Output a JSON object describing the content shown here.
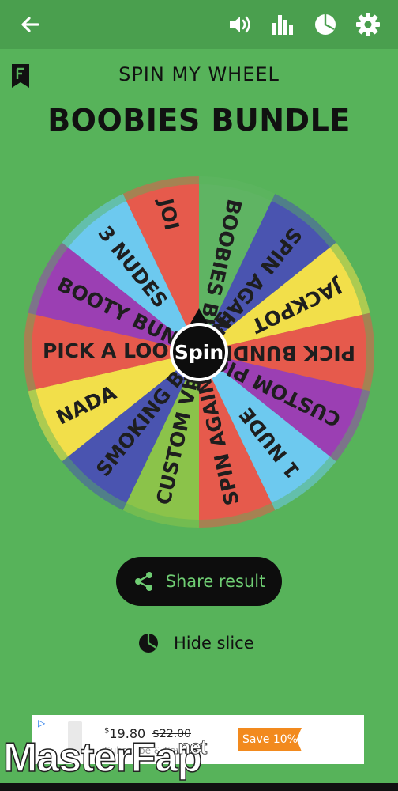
{
  "app": {
    "subtitle": "SPIN MY WHEEL",
    "wheel_title": "BOOBIES BUNDLE"
  },
  "toolbar": {
    "back_icon": "arrow-left-icon",
    "sound_icon": "volume-icon",
    "stats_icon": "bar-chart-icon",
    "pie_icon": "pie-chart-icon",
    "settings_icon": "gear-icon"
  },
  "wheel": {
    "spin_label": "Spin",
    "slices": [
      {
        "label": "BOOBIES BUNDLE",
        "color": "#5fb463"
      },
      {
        "label": "SPIN AGAIN",
        "color": "#4a54b0"
      },
      {
        "label": "JACKPOT",
        "color": "#f2df4a"
      },
      {
        "label": "PICK BUNDLE",
        "color": "#e65a4c"
      },
      {
        "label": "CUSTOM PIC",
        "color": "#9b3fb3"
      },
      {
        "label": "1 NUDE",
        "color": "#6dc9ef"
      },
      {
        "label": "SPIN AGAIN",
        "color": "#e65a4c"
      },
      {
        "label": "CUSTOM VID",
        "color": "#8bc34a"
      },
      {
        "label": "SMOKING BUNDLE",
        "color": "#4a54b0"
      },
      {
        "label": "NADA",
        "color": "#f2df4a"
      },
      {
        "label": "PICK A LOOK",
        "color": "#e65a4c"
      },
      {
        "label": "BOOTY BUNDLE",
        "color": "#9b3fb3"
      },
      {
        "label": "3 NUDES",
        "color": "#6dc9ef"
      },
      {
        "label": "JOI",
        "color": "#e65a4c"
      }
    ]
  },
  "actions": {
    "share_label": "Share result",
    "hide_label": "Hide slice"
  },
  "ad": {
    "choices_icon": "ad-choices-icon",
    "price": "19.80",
    "currency": "$",
    "old_price": "$22.00",
    "subscribe": "Subscribe & Save",
    "save_label": "Save 10%"
  },
  "watermark": {
    "part1": "Master",
    "part2": "Fap",
    "part3": ".net"
  },
  "colors": {
    "background": "#57b35a",
    "topbar": "#4a9f4e",
    "share_text": "#6fcd73"
  }
}
